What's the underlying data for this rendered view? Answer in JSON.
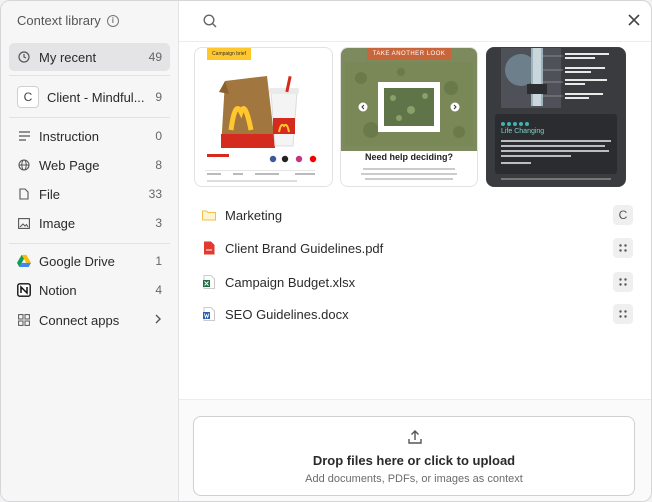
{
  "sidebar": {
    "title": "Context library",
    "items": [
      {
        "label": "My recent",
        "count": "49"
      },
      {
        "label": "Client - Mindful...",
        "count": "9",
        "badge": "C"
      },
      {
        "label": "Instruction",
        "count": "0"
      },
      {
        "label": "Web Page",
        "count": "8"
      },
      {
        "label": "File",
        "count": "33"
      },
      {
        "label": "Image",
        "count": "3"
      },
      {
        "label": "Google Drive",
        "count": "1"
      },
      {
        "label": "Notion",
        "count": "4"
      },
      {
        "label": "Connect apps"
      }
    ]
  },
  "thumbnails": {
    "t1": {
      "tag": "Campaign brief"
    },
    "t2": {
      "banner": "TAKE ANOTHER LOOK",
      "heading": "Need help deciding?"
    },
    "t3": {
      "quote_title": "Life Changing"
    }
  },
  "files": [
    {
      "name": "Marketing",
      "action": "C"
    },
    {
      "name": "Client Brand Guidelines.pdf"
    },
    {
      "name": "Campaign Budget.xlsx"
    },
    {
      "name": "SEO Guidelines.docx"
    }
  ],
  "upload": {
    "title": "Drop files here or click to upload",
    "subtitle": "Add documents, PDFs, or images as context"
  },
  "colors": {
    "accent_active": "#e4e4e6",
    "mcd_red": "#d52b1e",
    "mcd_yellow": "#ffc72c",
    "banner_orange": "#c8653a"
  }
}
